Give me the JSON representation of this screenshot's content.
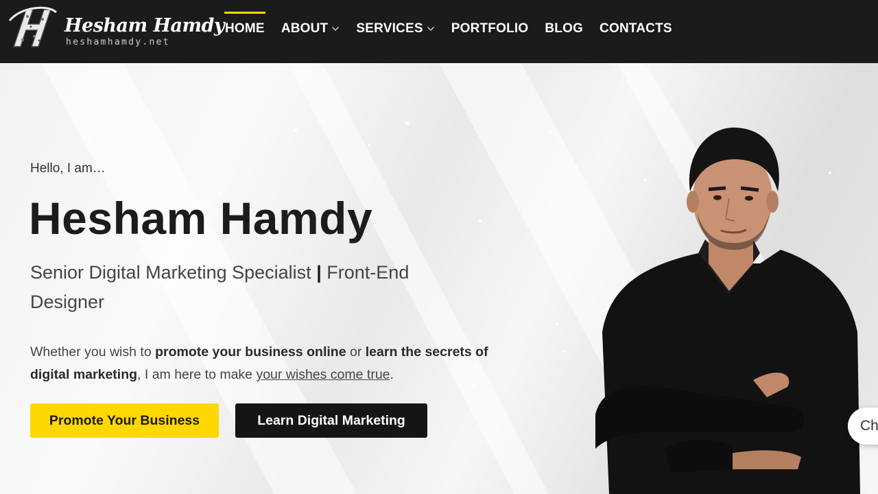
{
  "brand": {
    "name": "Hesham Hamdy",
    "domain": "heshamhamdy.net"
  },
  "nav": {
    "items": [
      {
        "label": "HOME",
        "active": true
      },
      {
        "label": "ABOUT",
        "dropdown": true
      },
      {
        "label": "SERVICES",
        "dropdown": true
      },
      {
        "label": "PORTFOLIO"
      },
      {
        "label": "BLOG"
      },
      {
        "label": "CONTACTS"
      }
    ]
  },
  "hero": {
    "greeting": "Hello, I am…",
    "title": "Hesham Hamdy",
    "subtitle_a": "Senior Digital Marketing Specialist",
    "subtitle_sep": "|",
    "subtitle_b": "Front-End Designer",
    "intro": {
      "t1": "Whether you wish to ",
      "b1": "promote your business online",
      "t2": " or ",
      "b2": "learn the secrets of digital marketing",
      "t3": ", I am here to make ",
      "link": "your wishes come true",
      "t4": "."
    },
    "primary_button": "Promote Your Business",
    "secondary_button": "Learn Digital Marketing"
  },
  "chat": {
    "label": "Ch"
  },
  "colors": {
    "header_bg": "#1b1b1b",
    "accent": "#ffd800",
    "dark_button": "#151515",
    "text": "#1c1c1c"
  },
  "icons": [
    "logo-h-monogram",
    "chevron-down-icon"
  ]
}
